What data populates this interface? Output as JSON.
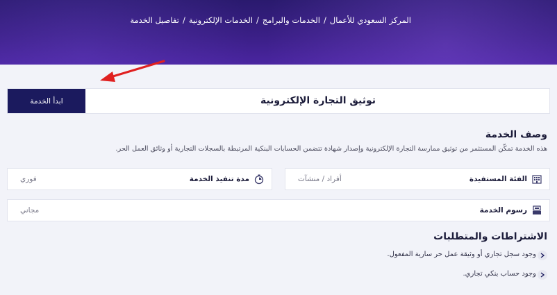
{
  "breadcrumb": {
    "items": [
      "المركز السعودي للأعمال",
      "الخدمات والبرامج",
      "الخدمات الإلكترونية",
      "تفاصيل الخدمة"
    ],
    "separator": "/"
  },
  "service": {
    "title": "توثيق التجارة الإلكترونية",
    "start_button": "ابدأ الخدمة"
  },
  "description": {
    "heading": "وصف الخدمة",
    "text": "هذه الخدمة تمكّن المستثمر من توثيق ممارسة التجارة الإلكترونية وإصدار شهادة تتضمن الحسابات البنكية المرتبطة بالسجلات التجارية أو وثائق العمل الحر."
  },
  "fields": {
    "beneficiary": {
      "label": "الفئة المستفيدة",
      "value": "أفراد / منشآت",
      "icon": "building-icon"
    },
    "duration": {
      "label": "مدة تنفيذ الخدمة",
      "value": "فوري",
      "icon": "stopwatch-icon"
    },
    "fees": {
      "label": "رسوم الخدمة",
      "value": "مجاني",
      "icon": "cash-register-icon"
    }
  },
  "requirements": {
    "heading": "الاشتراطات والمتطلبات",
    "items": [
      "وجود سجل تجاري أو وثيقة عمل حر سارية المفعول.",
      "وجود حساب بنكي تجاري."
    ]
  },
  "colors": {
    "hero": "#3a1f86",
    "button": "#1b1a5e",
    "annotation_arrow": "#e02020",
    "page_bg": "#f2f3f9"
  }
}
